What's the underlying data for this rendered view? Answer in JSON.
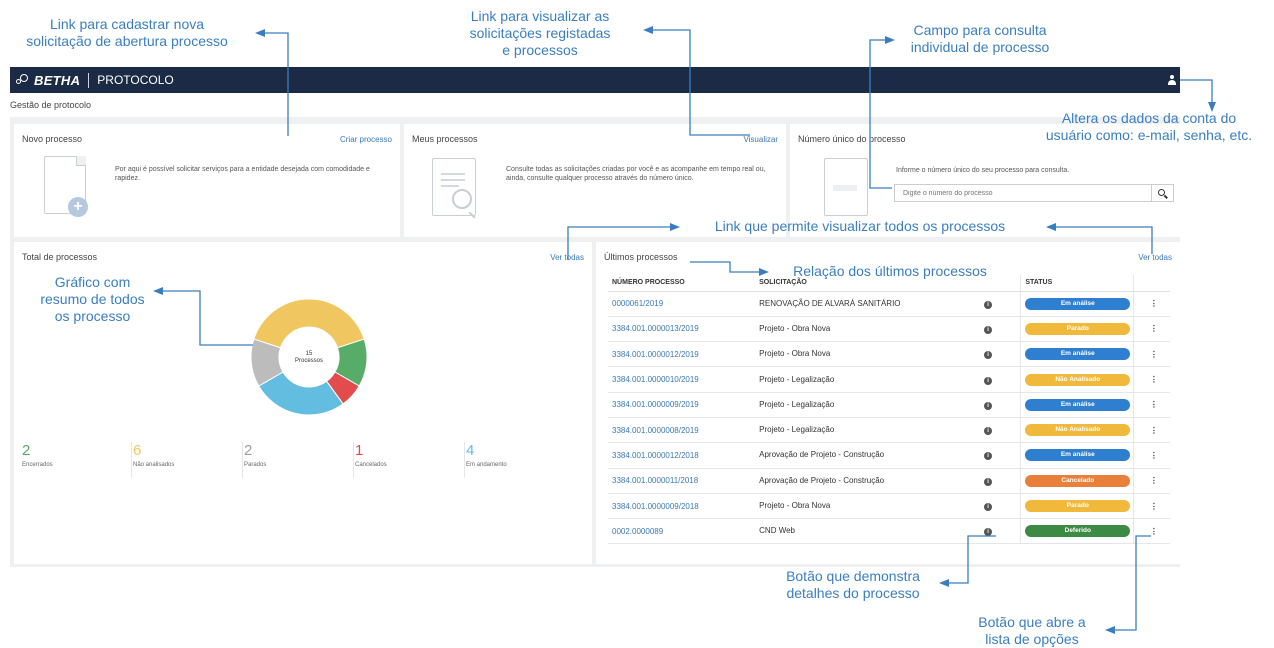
{
  "header": {
    "logo_text": "BETHA",
    "product": "PROTOCOLO"
  },
  "breadcrumb": "Gestão de protocolo",
  "novo_processo": {
    "title": "Novo processo",
    "link": "Criar processo",
    "description": "Por aqui é possível solicitar serviços para a entidade desejada com comodidade e rapidez."
  },
  "meus_processos": {
    "title": "Meus processos",
    "link": "Visualizar",
    "description": "Consulte todas as solicitações criadas por você e as acompanhe em tempo real ou, ainda, consulte qualquer processo através do número único."
  },
  "numero_unico": {
    "title": "Número único do processo",
    "instruction": "Informe o número único do seu processo para consulta.",
    "placeholder": "Digite o número do processo"
  },
  "total": {
    "title": "Total de processos",
    "link": "Ver todas",
    "center_count": "15",
    "center_label": "Processos",
    "stats": [
      {
        "num": "2",
        "label": "Encerrados",
        "color": "#57ad68"
      },
      {
        "num": "6",
        "label": "Não analisados",
        "color": "#f0c661"
      },
      {
        "num": "2",
        "label": "Parados",
        "color": "#9e9e9e"
      },
      {
        "num": "1",
        "label": "Cancelados",
        "color": "#e34c4c"
      },
      {
        "num": "4",
        "label": "Em andamento",
        "color": "#62bde0"
      }
    ]
  },
  "chart_data": {
    "type": "pie",
    "categories": [
      "Não analisados",
      "Encerrados",
      "Cancelados",
      "Em andamento",
      "Parados"
    ],
    "values": [
      6,
      2,
      1,
      4,
      2
    ],
    "colors": [
      "#f0c661",
      "#57ad68",
      "#e34c4c",
      "#62bde0",
      "#bcbcbc"
    ]
  },
  "ultimos": {
    "title": "Últimos processos",
    "link": "Ver todas",
    "columns": [
      "NÚMERO PROCESSO",
      "SOLICITAÇÃO",
      "STATUS"
    ],
    "info_glyph": "i",
    "menu_glyph": "⋮",
    "rows": [
      {
        "numero": "0000061/2019",
        "solicitacao": "RENOVAÇÃO DE ALVARÁ SANITÁRIO",
        "status": "Em análise",
        "color": "#2f7fd1"
      },
      {
        "numero": "3384.001.0000013/2019",
        "solicitacao": "Projeto - Obra Nova",
        "status": "Parado",
        "color": "#f0b93b"
      },
      {
        "numero": "3384.001.0000012/2019",
        "solicitacao": "Projeto - Obra Nova",
        "status": "Em análise",
        "color": "#2f7fd1"
      },
      {
        "numero": "3384.001.0000010/2019",
        "solicitacao": "Projeto - Legalização",
        "status": "Não Analisado",
        "color": "#f0b93b"
      },
      {
        "numero": "3384.001.0000009/2019",
        "solicitacao": "Projeto - Legalização",
        "status": "Em análise",
        "color": "#2f7fd1"
      },
      {
        "numero": "3384.001.0000008/2019",
        "solicitacao": "Projeto - Legalização",
        "status": "Não Analisado",
        "color": "#f0b93b"
      },
      {
        "numero": "3384.001.0000012/2018",
        "solicitacao": "Aprovação de Projeto - Construção",
        "status": "Em análise",
        "color": "#2f7fd1"
      },
      {
        "numero": "3384.001.0000011/2018",
        "solicitacao": "Aprovação de Projeto - Construção",
        "status": "Cancelado",
        "color": "#e8803a"
      },
      {
        "numero": "3384.001.0000009/2018",
        "solicitacao": "Projeto - Obra Nova",
        "status": "Parado",
        "color": "#f0b93b"
      },
      {
        "numero": "0002.0000089",
        "solicitacao": "CND Web",
        "status": "Deferido",
        "color": "#3d8a45"
      }
    ]
  },
  "annotations": {
    "criar": "Link para cadastrar nova\nsolicitação de abertura processo",
    "visualizar": "Link para visualizar as\nsolicitações registadas\ne processos",
    "consulta": "Campo para consulta\nindividual de processo",
    "conta": "Altera os dados da conta do\nusuário como: e-mail, senha, etc.",
    "ver_todas": "Link que permite visualizar todos os processos",
    "grafico": "Gráfico com\nresumo de todos\nos processo",
    "relacao": "Relação dos últimos processos",
    "detalhes": "Botão que demonstra\ndetalhes do processo",
    "opcoes": "Botão que abre a\nlista de opções"
  }
}
